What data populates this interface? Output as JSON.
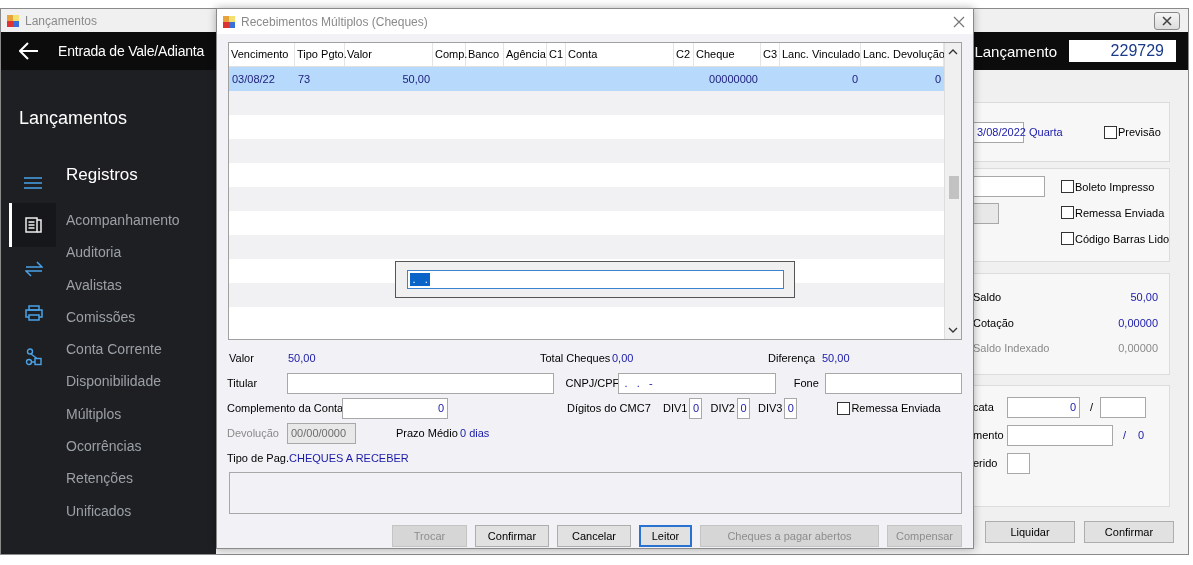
{
  "background_window": {
    "title": "Lançamentos",
    "header_title": "Entrada de Vale/Adianta",
    "lancamento_label": "Lançamento",
    "lancamento_value": "229729",
    "sidebar": {
      "heading": "Lançamentos",
      "section": "Registros",
      "nav_icons": [
        {
          "kind": "document",
          "selected": true
        },
        {
          "kind": "transfer",
          "selected": false
        },
        {
          "kind": "printer",
          "selected": false
        },
        {
          "kind": "network",
          "selected": false
        }
      ],
      "items": [
        "Acompanhamento",
        "Auditoria",
        "Avalistas",
        "Comissões",
        "Conta Corrente",
        "Disponibilidade",
        "Múltiplos",
        "Ocorrências",
        "Retenções",
        "Unificados"
      ]
    },
    "date_group": {
      "date": "3/08/2022",
      "weekday": "Quarta",
      "previsao": {
        "label": "Previsão",
        "checked": false
      }
    },
    "status_checkboxes": [
      {
        "label": "Boleto Impresso",
        "checked": false
      },
      {
        "label": "Remessa Enviada",
        "checked": false
      },
      {
        "label": "Código Barras Lido",
        "checked": false
      }
    ],
    "balance_rows": [
      {
        "label": "Saldo",
        "value": "50,00",
        "disabled": false
      },
      {
        "label": "Cotação",
        "value": "0,00000",
        "disabled": false
      },
      {
        "label": "Saldo Indexado",
        "value": "0,00000",
        "disabled": true
      }
    ],
    "duplicata": {
      "label": "cata",
      "value": "0",
      "separator": "/"
    },
    "parcelamento": {
      "label": "mento",
      "separator": "/",
      "total": "0"
    },
    "conferido": {
      "label": "erido"
    },
    "buttons": [
      "Liquidar",
      "Confirmar"
    ]
  },
  "dialog": {
    "title": "Recebimentos Múltiplos (Cheques)",
    "columns": [
      "Vencimento",
      "Tipo Pgto.",
      "Valor",
      "Comp.",
      "Banco",
      "Agência",
      "C1",
      "Conta",
      "C2",
      "Cheque",
      "C3",
      "Lanc. Vinculado",
      "Lanc. Devolução"
    ],
    "rows": [
      {
        "selected": true,
        "cells": [
          "03/08/22",
          "73",
          "50,00",
          null,
          null,
          null,
          null,
          null,
          null,
          "00000000",
          null,
          "0",
          "0"
        ]
      }
    ],
    "reader_field": {
      "value": " .   ."
    },
    "valor": {
      "label": "Valor",
      "value": "50,00"
    },
    "total_cheques": {
      "label": "Total Cheques",
      "value": "0,00"
    },
    "diferenca": {
      "label": "Diferença",
      "value": "50,00"
    },
    "titular": {
      "label": "Titular"
    },
    "cnpj_cpf": {
      "label": "CNPJ/CPF",
      "value": " .   .   -"
    },
    "fone": {
      "label": "Fone"
    },
    "complemento": {
      "label": "Complemento da Conta",
      "value": "0"
    },
    "digitos": {
      "label": "Dígitos do CMC7",
      "divs": [
        {
          "label": "DIV1",
          "value": "0"
        },
        {
          "label": "DIV2",
          "value": "0"
        },
        {
          "label": "DIV3",
          "value": "0"
        }
      ]
    },
    "remessa": {
      "label": "Remessa Enviada",
      "checked": false
    },
    "devolucao": {
      "label": "Devolução",
      "value": "00/00/0000",
      "disabled": true
    },
    "prazo": {
      "label": "Prazo Médio",
      "value": "0 dias"
    },
    "tipo_pag": {
      "label": "Tipo de Pag.",
      "value": "CHEQUES A RECEBER"
    },
    "buttons": [
      {
        "label": "Trocar",
        "disabled": true,
        "focused": false
      },
      {
        "label": "Confirmar",
        "disabled": false,
        "focused": false
      },
      {
        "label": "Cancelar",
        "disabled": false,
        "focused": false
      },
      {
        "label": "Leitor",
        "disabled": false,
        "focused": true
      },
      {
        "label": "Cheques a pagar abertos",
        "disabled": true,
        "focused": false
      },
      {
        "label": "Compensar",
        "disabled": true,
        "focused": false
      }
    ]
  }
}
